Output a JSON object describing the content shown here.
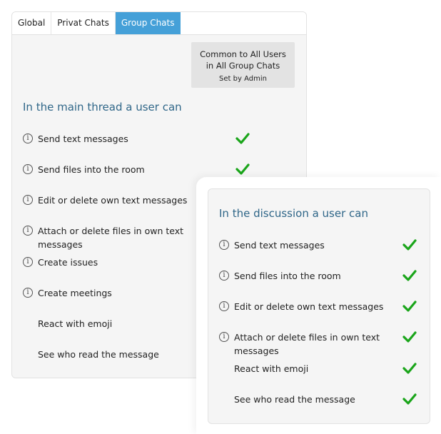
{
  "tabs": [
    {
      "label": "Global",
      "active": false
    },
    {
      "label": "Privat Chats",
      "active": false
    },
    {
      "label": "Group Chats",
      "active": true
    }
  ],
  "common_box": {
    "title_line1": "Common to All Users",
    "title_line2": "in All Group Chats",
    "subtitle": "Set by Admin"
  },
  "main_thread": {
    "title": "In the main thread a user can",
    "items": [
      {
        "label": "Send text messages",
        "info": true,
        "checked": true
      },
      {
        "label": "Send files into the room",
        "info": true,
        "checked": true
      },
      {
        "label": "Edit or delete own text messages",
        "info": true
      },
      {
        "label": "Attach or delete files in own text messages",
        "info": true
      },
      {
        "label": "Create issues",
        "info": true
      },
      {
        "label": "Create meetings",
        "info": true
      },
      {
        "label": "React with emoji",
        "info": false
      },
      {
        "label": "See who read the message",
        "info": false
      }
    ]
  },
  "discussion": {
    "title": "In the discussion a user can",
    "items": [
      {
        "label": "Send text messages",
        "info": true,
        "checked": true
      },
      {
        "label": "Send files into the room",
        "info": true,
        "checked": true
      },
      {
        "label": "Edit or delete own text messages",
        "info": true,
        "checked": true
      },
      {
        "label": "Attach or delete files in own text messages",
        "info": true,
        "checked": true
      },
      {
        "label": "React with emoji",
        "info": false,
        "checked": true
      },
      {
        "label": "See who read the message",
        "info": false,
        "checked": true
      }
    ]
  },
  "colors": {
    "accent": "#45a0d8",
    "title": "#2f6688",
    "check": "#1aa51a"
  },
  "icons": {
    "info": "info-circle-icon",
    "check": "checkmark-icon"
  }
}
